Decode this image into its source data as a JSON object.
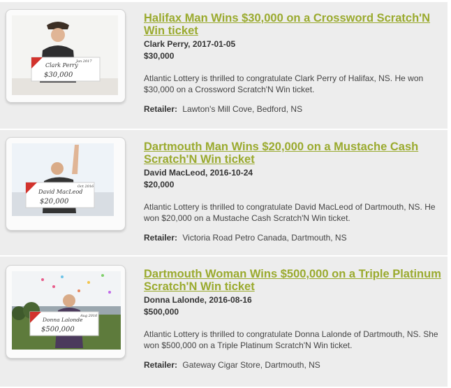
{
  "winners": [
    {
      "title": "Halifax Man Wins $30,000 on a Crossword Scratch'N Win ticket",
      "name_date": "Clark Perry, 2017-01-05",
      "amount": "$30,000",
      "description": "Atlantic Lottery is thrilled to congratulate Clark Perry of Halifax, NS. He won $30,000 on a Crossword Scratch'N Win ticket.",
      "retailer_label": "Retailer:",
      "retailer": "Lawton's Mill Cove, Bedford, NS",
      "cheque_name": "Clark Perry",
      "cheque_amount": "$30,000",
      "cheque_date": "Jan 2017"
    },
    {
      "title": "Dartmouth Man Wins $20,000 on a Mustache Cash Scratch'N Win ticket",
      "name_date": "David MacLeod, 2016-10-24",
      "amount": "$20,000",
      "description": "Atlantic Lottery is thrilled to congratulate David MacLeod of Dartmouth, NS. He won $20,000 on a Mustache Cash Scratch'N Win ticket.",
      "retailer_label": "Retailer:",
      "retailer": "Victoria Road Petro Canada, Dartmouth, NS",
      "cheque_name": "David MacLeod",
      "cheque_amount": "$20,000",
      "cheque_date": "Oct 2016"
    },
    {
      "title": "Dartmouth Woman Wins $500,000 on a Triple Platinum Scratch'N Win ticket",
      "name_date": "Donna Lalonde, 2016-08-16",
      "amount": "$500,000",
      "description": "Atlantic Lottery is thrilled to congratulate Donna Lalonde of Dartmouth, NS. She won $500,000 on a Triple Platinum Scratch'N Win ticket.",
      "retailer_label": "Retailer:",
      "retailer": "Gateway Cigar Store, Dartmouth, NS",
      "cheque_name": "Donna Lalonde",
      "cheque_amount": "$500,000",
      "cheque_date": "Aug 2016"
    }
  ]
}
